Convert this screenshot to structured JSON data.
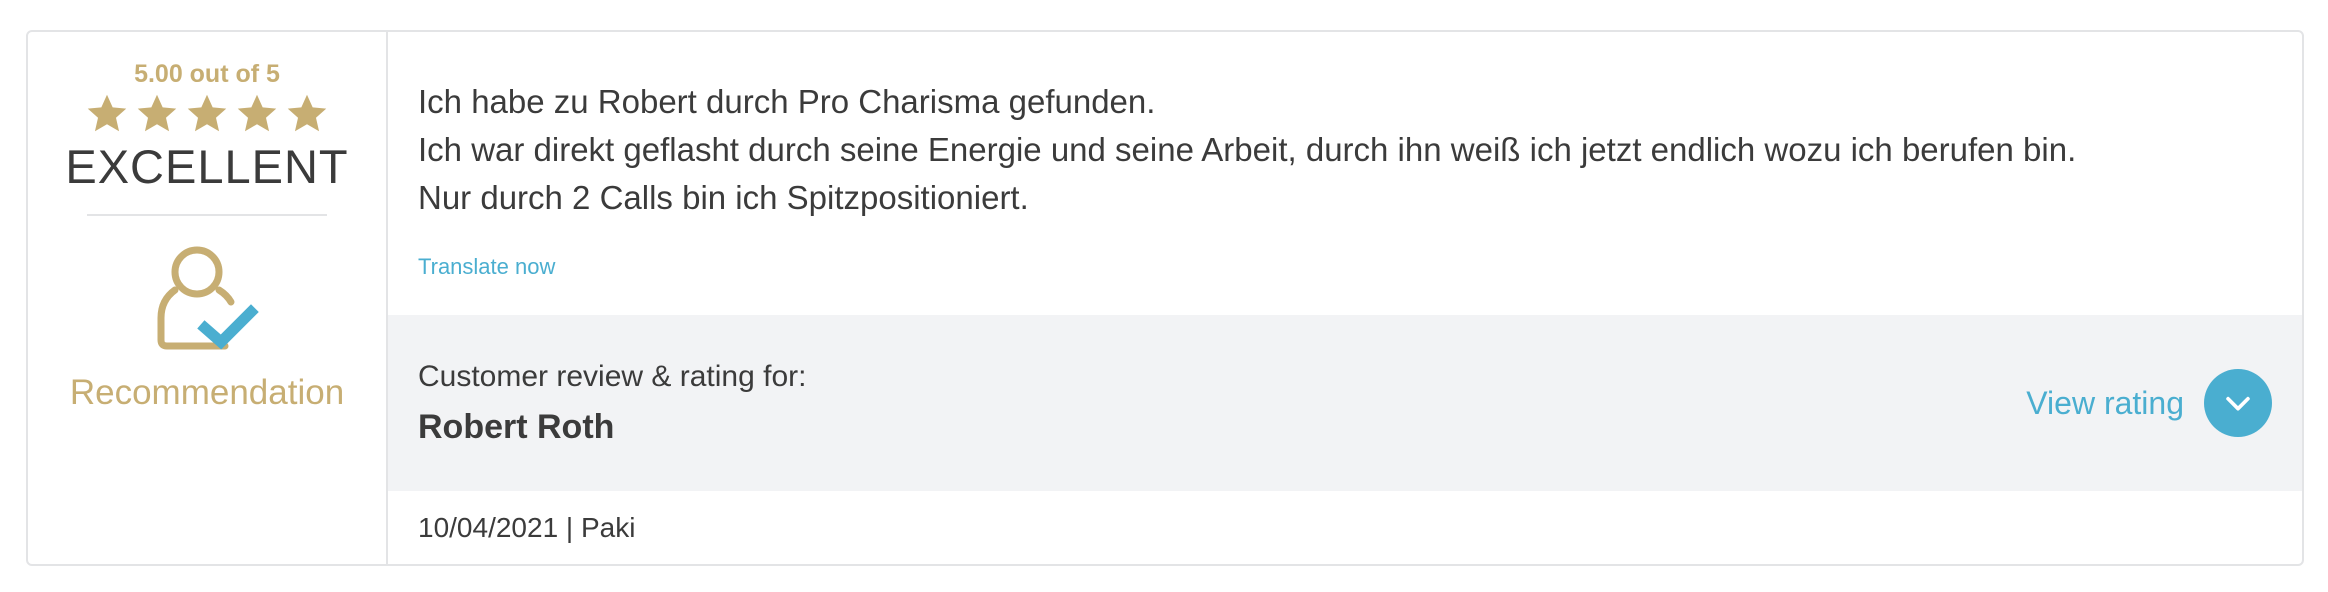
{
  "rating": {
    "score_text": "5.00 out of 5",
    "stars": 5,
    "max_stars": 5,
    "grade": "EXCELLENT",
    "recommendation_label": "Recommendation",
    "accent_color": "#c7ae73",
    "check_color": "#4aaed0"
  },
  "review": {
    "lines": [
      "Ich habe zu Robert durch Pro Charisma gefunden.",
      "Ich war direkt geflasht durch seine Energie und seine Arbeit, durch ihn weiß ich jetzt endlich wozu ich berufen bin.",
      "Nur durch 2 Calls bin ich Spitzpositioniert."
    ],
    "translate_label": "Translate now"
  },
  "target": {
    "caption": "Customer review & rating for:",
    "name": "Robert Roth",
    "view_label": "View rating",
    "view_icon": "chevron-down-icon"
  },
  "meta": {
    "date_author": "10/04/2021 | Paki"
  }
}
